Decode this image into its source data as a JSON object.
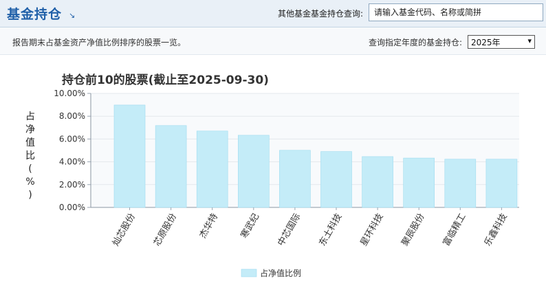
{
  "header": {
    "title": "基金持仓",
    "arrow_icon": "↘",
    "search_label": "其他基金基金持仓查询:",
    "search_placeholder": "请输入基金代码、名称或简拼"
  },
  "subbar": {
    "description": "报告期末占基金资产净值比例排序的股票一览。",
    "year_label": "查询指定年度的基金持仓:",
    "year_value": "2025年",
    "dropdown_icon": "▾"
  },
  "chart_data": {
    "type": "bar",
    "title": "持仓前10的股票(截止至2025-09-30)",
    "ylabel": "占净值比(%)",
    "xlabel": "",
    "categories": [
      "灿芯股份",
      "芯原股份",
      "杰华特",
      "寒武纪",
      "中芯国际",
      "东土科技",
      "星环科技",
      "聚辰股份",
      "富临精工",
      "乐鑫科技"
    ],
    "series": [
      {
        "name": "占净值比例",
        "values": [
          8.98,
          7.18,
          6.7,
          6.33,
          5.01,
          4.9,
          4.46,
          4.33,
          4.23,
          4.23
        ]
      }
    ],
    "ylim": [
      0,
      10
    ],
    "yticks": [
      0,
      2,
      4,
      6,
      8,
      10
    ],
    "ytick_labels": [
      "0.00%",
      "2.00%",
      "4.00%",
      "6.00%",
      "8.00%",
      "10.00%"
    ],
    "grid": true,
    "legend": "bottom",
    "bar_color": "#c4ecf8",
    "bar_edge_color": "#9fdcf0"
  }
}
